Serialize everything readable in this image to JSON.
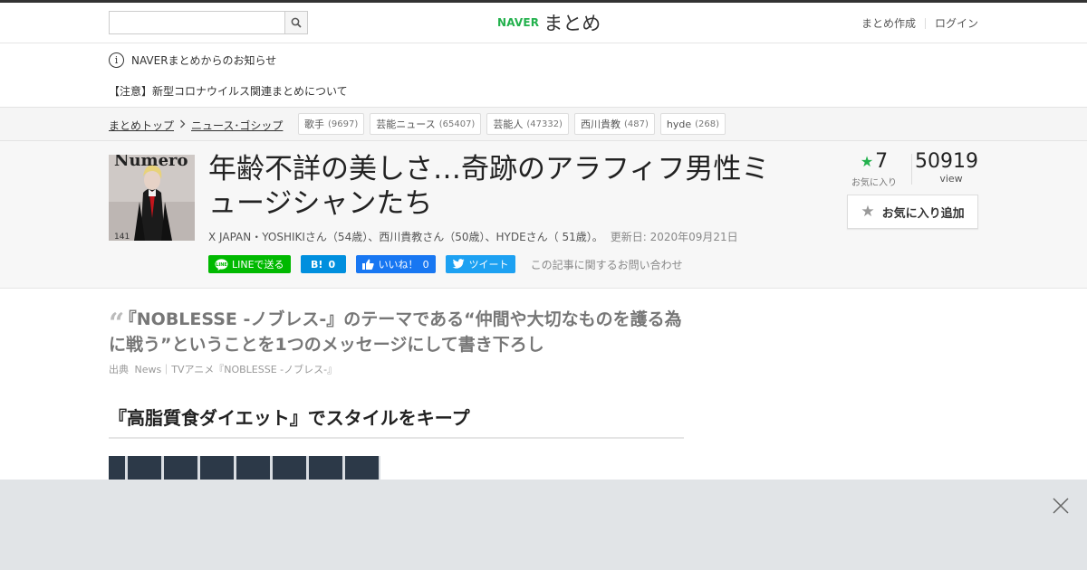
{
  "header": {
    "search": {
      "value": "",
      "placeholder": ""
    },
    "logo": {
      "brand": "NAVER",
      "name": "まとめ"
    },
    "links": [
      {
        "label": "まとめ作成"
      },
      {
        "label": "ログイン"
      }
    ]
  },
  "notices": [
    {
      "text": "NAVERまとめからのお知らせ"
    },
    {
      "text": "【注意】新型コロナウイルス関連まとめについて"
    }
  ],
  "breadcrumb": [
    {
      "label": "まとめトップ"
    },
    {
      "label": "ニュース･ゴシップ"
    }
  ],
  "tags": [
    {
      "label": "歌手",
      "count": "(9697)"
    },
    {
      "label": "芸能ニュース",
      "count": "(65407)"
    },
    {
      "label": "芸能人",
      "count": "(47332)"
    },
    {
      "label": "西川貴教",
      "count": "(487)"
    },
    {
      "label": "hyde",
      "count": "(268)"
    }
  ],
  "article": {
    "title": "年齢不詳の美しさ…奇跡のアラフィフ男性ミュージシャンたち",
    "byline": "X JAPAN・YOSHIKIさん（54歳）、西川貴教さん（50歳）、HYDEさん（ 51歳）。",
    "updated": "更新日: 2020年09月21日",
    "thumb": {
      "masthead": "Numero",
      "issue": "141"
    },
    "social": {
      "line": "LINEで送る",
      "hatena_label": "B!",
      "hatena_count": "0",
      "fb_label": "いいね！",
      "fb_count": "0",
      "tweet": "ツイート",
      "contact": "この記事に関するお問い合わせ"
    },
    "favorites": {
      "count": "7",
      "label": "お気に入り"
    },
    "views": {
      "count": "50919",
      "label": "view"
    },
    "fav_button": "お気に入り追加"
  },
  "quote": {
    "text": "『NOBLESSE -ノブレス-』のテーマである“仲間や大切なものを護る為に戦う”ということを1つのメッセージにして書き下ろし",
    "source_label": "出典",
    "source_text": "News｜TVアニメ『NOBLESSE -ノブレス-』"
  },
  "section_heading": "『高脂質食ダイエット』でスタイルをキープ",
  "colors": {
    "naver_green": "#23b14d",
    "line": "#00b900",
    "hatena": "#008fde",
    "facebook": "#1877f2",
    "twitter": "#1da1f2",
    "ad_bar": "#e1e4e7"
  }
}
